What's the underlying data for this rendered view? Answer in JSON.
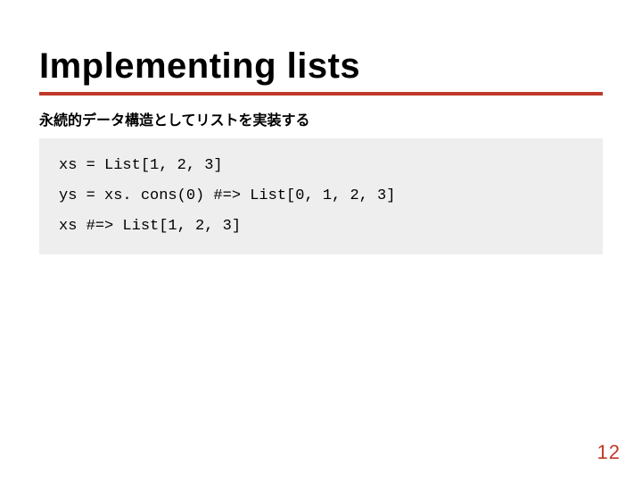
{
  "title": "Implementing lists",
  "subtitle": "永続的データ構造としてリストを実装する",
  "code": {
    "line1": "xs = List[1, 2, 3]",
    "line2": "ys = xs. cons(0) #=> List[0, 1, 2, 3]",
    "line3": "xs #=> List[1, 2, 3]"
  },
  "page_number": "12",
  "accent_color": "#c0392b"
}
